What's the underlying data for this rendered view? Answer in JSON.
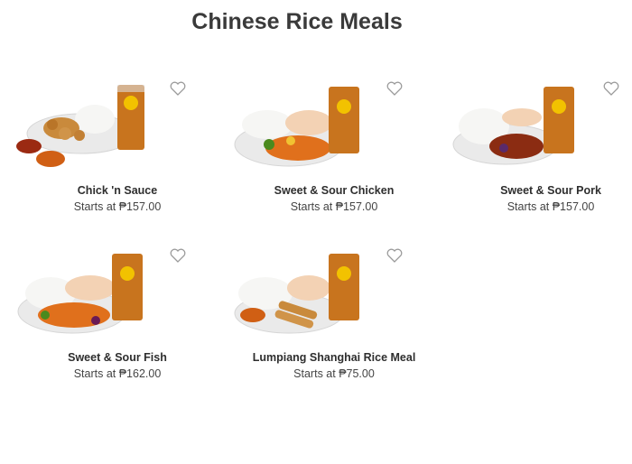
{
  "page": {
    "title": "Chinese Rice Meals"
  },
  "theme": {
    "heart_stroke": "#9a9a9a",
    "rice": "#f4f4f2",
    "plate": "#e9e9e9",
    "iced_tea": "#c8741e",
    "cup_logo": "#f2c200"
  },
  "items": [
    {
      "name": "Chick 'n Sauce",
      "price": "Starts at ₱157.00",
      "icon": "heart-icon"
    },
    {
      "name": "Sweet & Sour Chicken",
      "price": "Starts at ₱157.00",
      "icon": "heart-icon"
    },
    {
      "name": "Sweet & Sour Pork",
      "price": "Starts at ₱157.00",
      "icon": "heart-icon"
    },
    {
      "name": "Sweet & Sour Fish",
      "price": "Starts at ₱162.00",
      "icon": "heart-icon"
    },
    {
      "name": "Lumpiang Shanghai Rice Meal",
      "price": "Starts at ₱75.00",
      "icon": "heart-icon"
    }
  ]
}
